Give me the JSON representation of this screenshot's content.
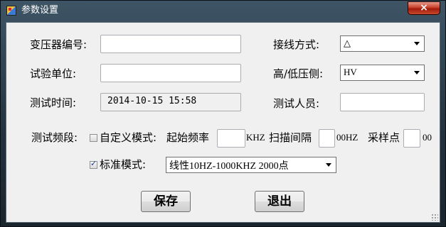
{
  "window": {
    "title": "参数设置",
    "close_label": "×"
  },
  "fields": {
    "transformer_no": {
      "label": "变压器编号:",
      "value": ""
    },
    "test_unit": {
      "label": "试验单位:",
      "value": ""
    },
    "test_time": {
      "label": "测试时间:",
      "value": "2014-10-15 15:58"
    },
    "wiring": {
      "label": "接线方式:",
      "value": "△"
    },
    "side": {
      "label": "高/低压侧:",
      "value": "HV"
    },
    "tester": {
      "label": "测试人员:",
      "value": ""
    }
  },
  "frequency": {
    "label": "测试频段:",
    "custom_mode_label": "自定义模式:",
    "custom_mode_checked": false,
    "start_freq_label": "起始频率",
    "start_freq_unit": "KHZ",
    "scan_interval_label": "扫描间隔",
    "scan_interval_unit": "00HZ",
    "sample_points_label": "采样点",
    "sample_points_suffix": "00",
    "standard_mode_label": "标准模式:",
    "standard_mode_checked": true,
    "standard_mode_value": "线性10HZ-1000KHZ 2000点"
  },
  "buttons": {
    "save": "保存",
    "exit": "退出"
  }
}
